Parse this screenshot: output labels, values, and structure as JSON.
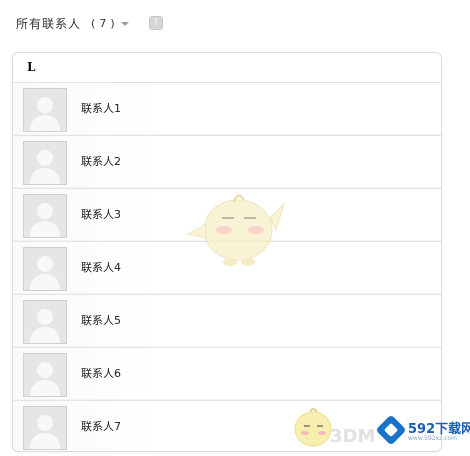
{
  "header": {
    "title": "所有联系人",
    "count_open": "(",
    "count_value": "7",
    "count_close": ")",
    "help_icon": "help-icon"
  },
  "group": {
    "letter": "L"
  },
  "contacts": [
    {
      "name": "联系人1",
      "avatar_icon": "default-avatar-icon"
    },
    {
      "name": "联系人2",
      "avatar_icon": "default-avatar-icon"
    },
    {
      "name": "联系人3",
      "avatar_icon": "default-avatar-icon"
    },
    {
      "name": "联系人4",
      "avatar_icon": "default-avatar-icon"
    },
    {
      "name": "联系人5",
      "avatar_icon": "default-avatar-icon"
    },
    {
      "name": "联系人6",
      "avatar_icon": "default-avatar-icon"
    },
    {
      "name": "联系人7",
      "avatar_icon": "default-avatar-icon"
    }
  ],
  "watermark": {
    "text_3d": "3DM",
    "site_logo": "592下载网",
    "site_url": "www.592xz.com"
  },
  "colors": {
    "border": "#dcdcdc",
    "row_divider": "#e4e4e4",
    "avatar_bg": "#eaeaea",
    "logo_blue": "#1a73c8"
  }
}
